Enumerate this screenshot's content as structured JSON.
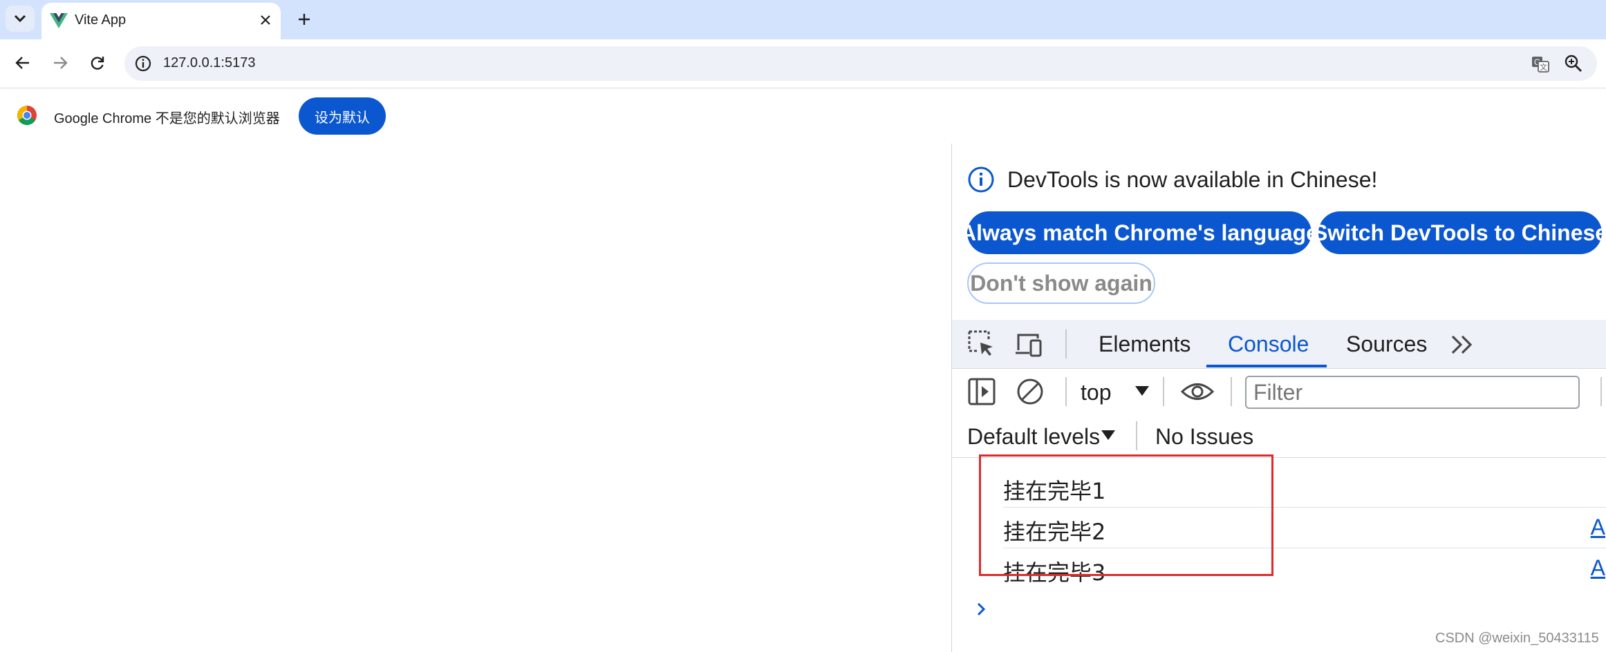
{
  "browser": {
    "tab": {
      "title": "Vite App"
    },
    "address": {
      "url": "127.0.0.1:5173"
    },
    "infobar": {
      "text": "Google Chrome 不是您的默认浏览器",
      "button_label": "设为默认"
    }
  },
  "devtools": {
    "language_prompt": {
      "message": "DevTools is now available in Chinese!",
      "match_label": "Always match Chrome's language",
      "switch_label": "Switch DevTools to Chinese",
      "dismiss_label": "Don't show again"
    },
    "tabs": [
      {
        "label": "Elements",
        "active": false
      },
      {
        "label": "Console",
        "active": true
      },
      {
        "label": "Sources",
        "active": false
      }
    ],
    "console": {
      "context": "top",
      "filter_placeholder": "Filter",
      "levels_label": "Default levels",
      "issues_label": "No Issues",
      "logs": [
        {
          "text": "挂在完毕1",
          "source": ""
        },
        {
          "text": "挂在完毕2",
          "source": "A"
        },
        {
          "text": "挂在完毕3",
          "source": "A"
        }
      ]
    }
  },
  "watermark": "CSDN @weixin_50433115",
  "colors": {
    "accent": "#0b57d0",
    "tabstrip": "#d3e3fd",
    "highlight": "#e0292b"
  },
  "icons": [
    "tab-search-icon",
    "vue-logo-icon",
    "close-icon",
    "plus-icon",
    "back-icon",
    "forward-icon",
    "reload-icon",
    "info-icon",
    "translate-icon",
    "zoom-icon",
    "chrome-logo-icon",
    "inspect-element-icon",
    "device-toolbar-icon",
    "more-tabs-icon",
    "sidebar-icon",
    "clear-console-icon",
    "eye-icon",
    "caret-down-icon",
    "prompt-chevron-icon"
  ]
}
